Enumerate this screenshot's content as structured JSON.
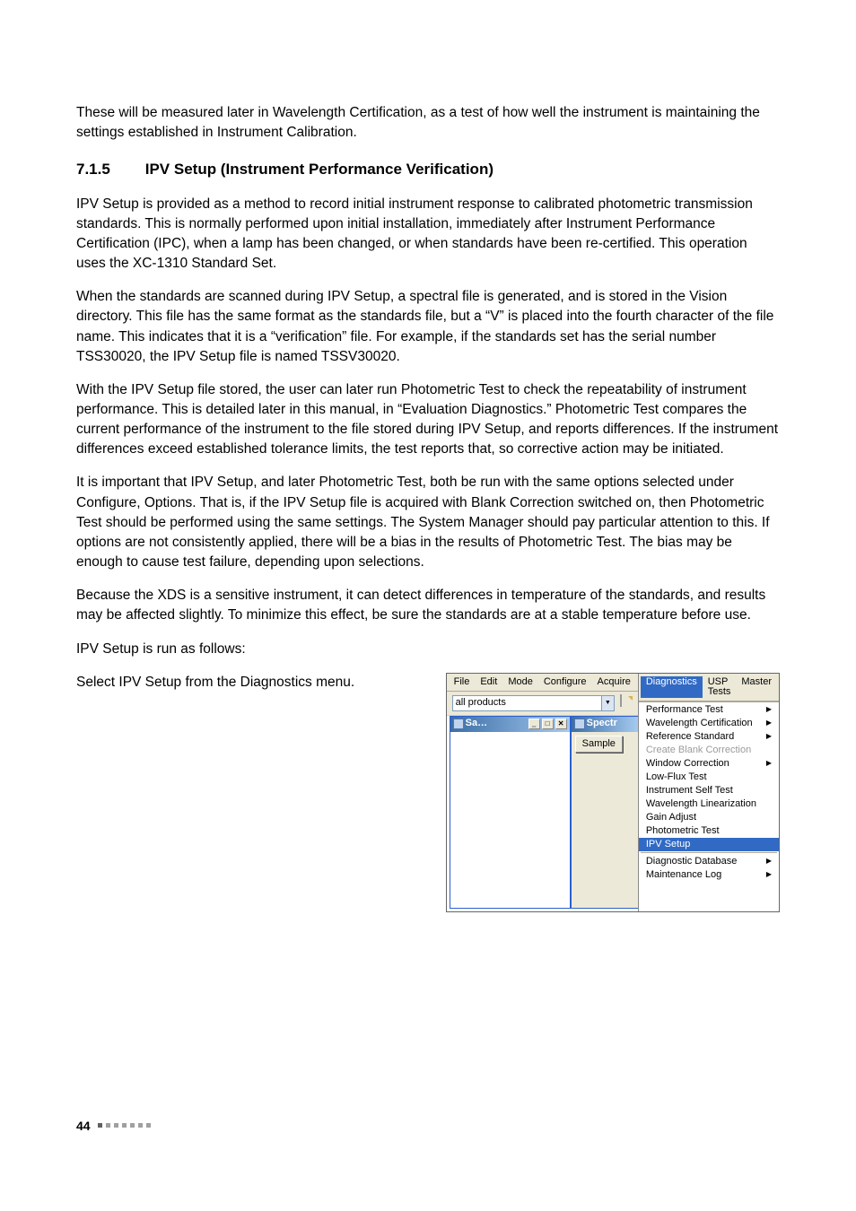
{
  "para_intro": "These will be measured later in Wavelength Certification, as a test of how well the instrument is maintaining the settings established in Instrument Calibration.",
  "section": {
    "number": "7.1.5",
    "title": "IPV Setup (Instrument Performance Verification)"
  },
  "para1": "IPV Setup is provided as a method to record initial instrument response to calibrated photometric transmission standards. This is normally performed upon initial installation, immediately after Instrument Performance Certification (IPC), when a lamp has been changed, or when standards have been re-certified. This operation uses the XC-1310 Standard Set.",
  "para2": "When the standards are scanned during IPV Setup, a spectral file is generated, and is stored in the Vision directory. This file has the same format as the standards file, but a “V” is placed into the fourth character of the file name. This indicates that it is a “verification” file. For example, if the standards set has the serial number TSS30020, the IPV Setup file is named TSSV30020.",
  "para3": "With the IPV Setup file stored, the user can later run Photometric Test to check the repeatability of instrument performance. This is detailed later in this manual, in “Evaluation Diagnostics.” Photometric Test compares the current performance of the instrument to the file stored during IPV Setup, and reports differences. If the instrument differences exceed established tolerance limits, the test reports that, so corrective action may be initiated.",
  "para4": "It is important that IPV Setup, and later Photometric Test, both be run with the same options selected under Configure, Options. That is, if the IPV Setup file is acquired with Blank Correction switched on, then Photometric Test should be performed using the same settings. The System Manager should pay particular attention to this. If options are not consistently applied, there will be a bias in the results of Photometric Test. The bias may be enough to cause test failure, depending upon selections.",
  "para5": "Because the XDS is a sensitive instrument, it can detect differences in temperature of the standards, and results may be affected slightly. To minimize this effect, be sure the standards are at a stable temperature before use.",
  "para6": "IPV Setup is run as follows:",
  "para7": "Select IPV Setup from the Diagnostics menu.",
  "screenshot": {
    "left": {
      "menus": [
        "File",
        "Edit",
        "Mode",
        "Configure",
        "Acquire"
      ],
      "combo": "all products",
      "subwin_sa": "Sa…",
      "subwin_spectr": "Spectr",
      "sample_btn": "Sample"
    },
    "right": {
      "menus": {
        "diagnostics": "Diagnostics",
        "usp": "USP Tests",
        "master": "Master"
      },
      "items": [
        {
          "label": "Performance Test",
          "submenu": true
        },
        {
          "label": "Wavelength Certification",
          "submenu": true
        },
        {
          "label": "Reference Standard",
          "submenu": true
        },
        {
          "label": "Create Blank Correction",
          "disabled": true
        },
        {
          "label": "Window Correction",
          "submenu": true
        },
        {
          "label": "Low-Flux Test"
        },
        {
          "label": "Instrument Self Test"
        },
        {
          "label": "Wavelength Linearization"
        },
        {
          "label": "Gain Adjust"
        },
        {
          "label": "Photometric Test"
        },
        {
          "label": "IPV Setup",
          "selected": true
        },
        {
          "separator": true
        },
        {
          "label": "Diagnostic Database",
          "submenu": true
        },
        {
          "label": "Maintenance Log",
          "submenu": true
        }
      ]
    }
  },
  "page_number": "44"
}
